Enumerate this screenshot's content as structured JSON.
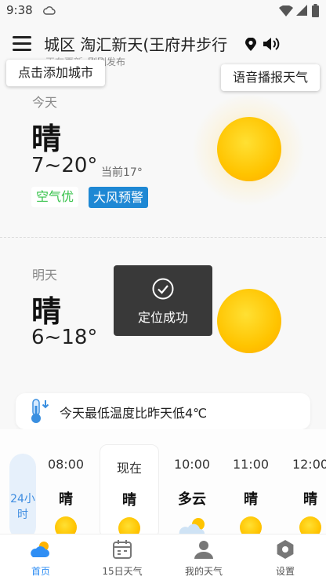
{
  "status_bar": {
    "time": "9:38"
  },
  "header": {
    "location": "城区 淘汇新天(王府井步行",
    "publish_updating": "正在更新",
    "publish_status": "刚刚发布"
  },
  "tooltips": {
    "add_city": "点击添加城市",
    "voice_broadcast": "语音播报天气"
  },
  "today": {
    "label": "今天",
    "condition": "晴",
    "temp_range": "7~20°",
    "current_temp": "当前17°",
    "aqi": "空气优",
    "warning": "大风预警"
  },
  "tomorrow": {
    "label": "明天",
    "condition": "晴",
    "temp_range": "6~18°"
  },
  "toast": {
    "text": "定位成功"
  },
  "tip": {
    "text": "今天最低温度比昨天低4℃"
  },
  "hourly": {
    "pill_label": "24小时",
    "items": [
      {
        "time": "08:00",
        "condition": "晴",
        "icon": "sun-icon"
      },
      {
        "time": "现在",
        "condition": "晴",
        "icon": "sun-icon"
      },
      {
        "time": "10:00",
        "condition": "多云",
        "icon": "cloud-sun-icon"
      },
      {
        "time": "11:00",
        "condition": "晴",
        "icon": "sun-icon"
      },
      {
        "time": "12:00",
        "condition": "晴",
        "icon": "sun-icon"
      }
    ]
  },
  "nav": {
    "items": [
      {
        "label": "首页",
        "icon": "home-weather-icon",
        "active": true
      },
      {
        "label": "15日天气",
        "icon": "calendar-icon",
        "active": false
      },
      {
        "label": "我的天气",
        "icon": "person-icon",
        "active": false
      },
      {
        "label": "设置",
        "icon": "settings-icon",
        "active": false
      }
    ]
  },
  "colors": {
    "accent": "#2f8ef4",
    "warning_bg": "#1e88d4",
    "aqi_green": "#36c24a",
    "sun": "#ffc400"
  }
}
